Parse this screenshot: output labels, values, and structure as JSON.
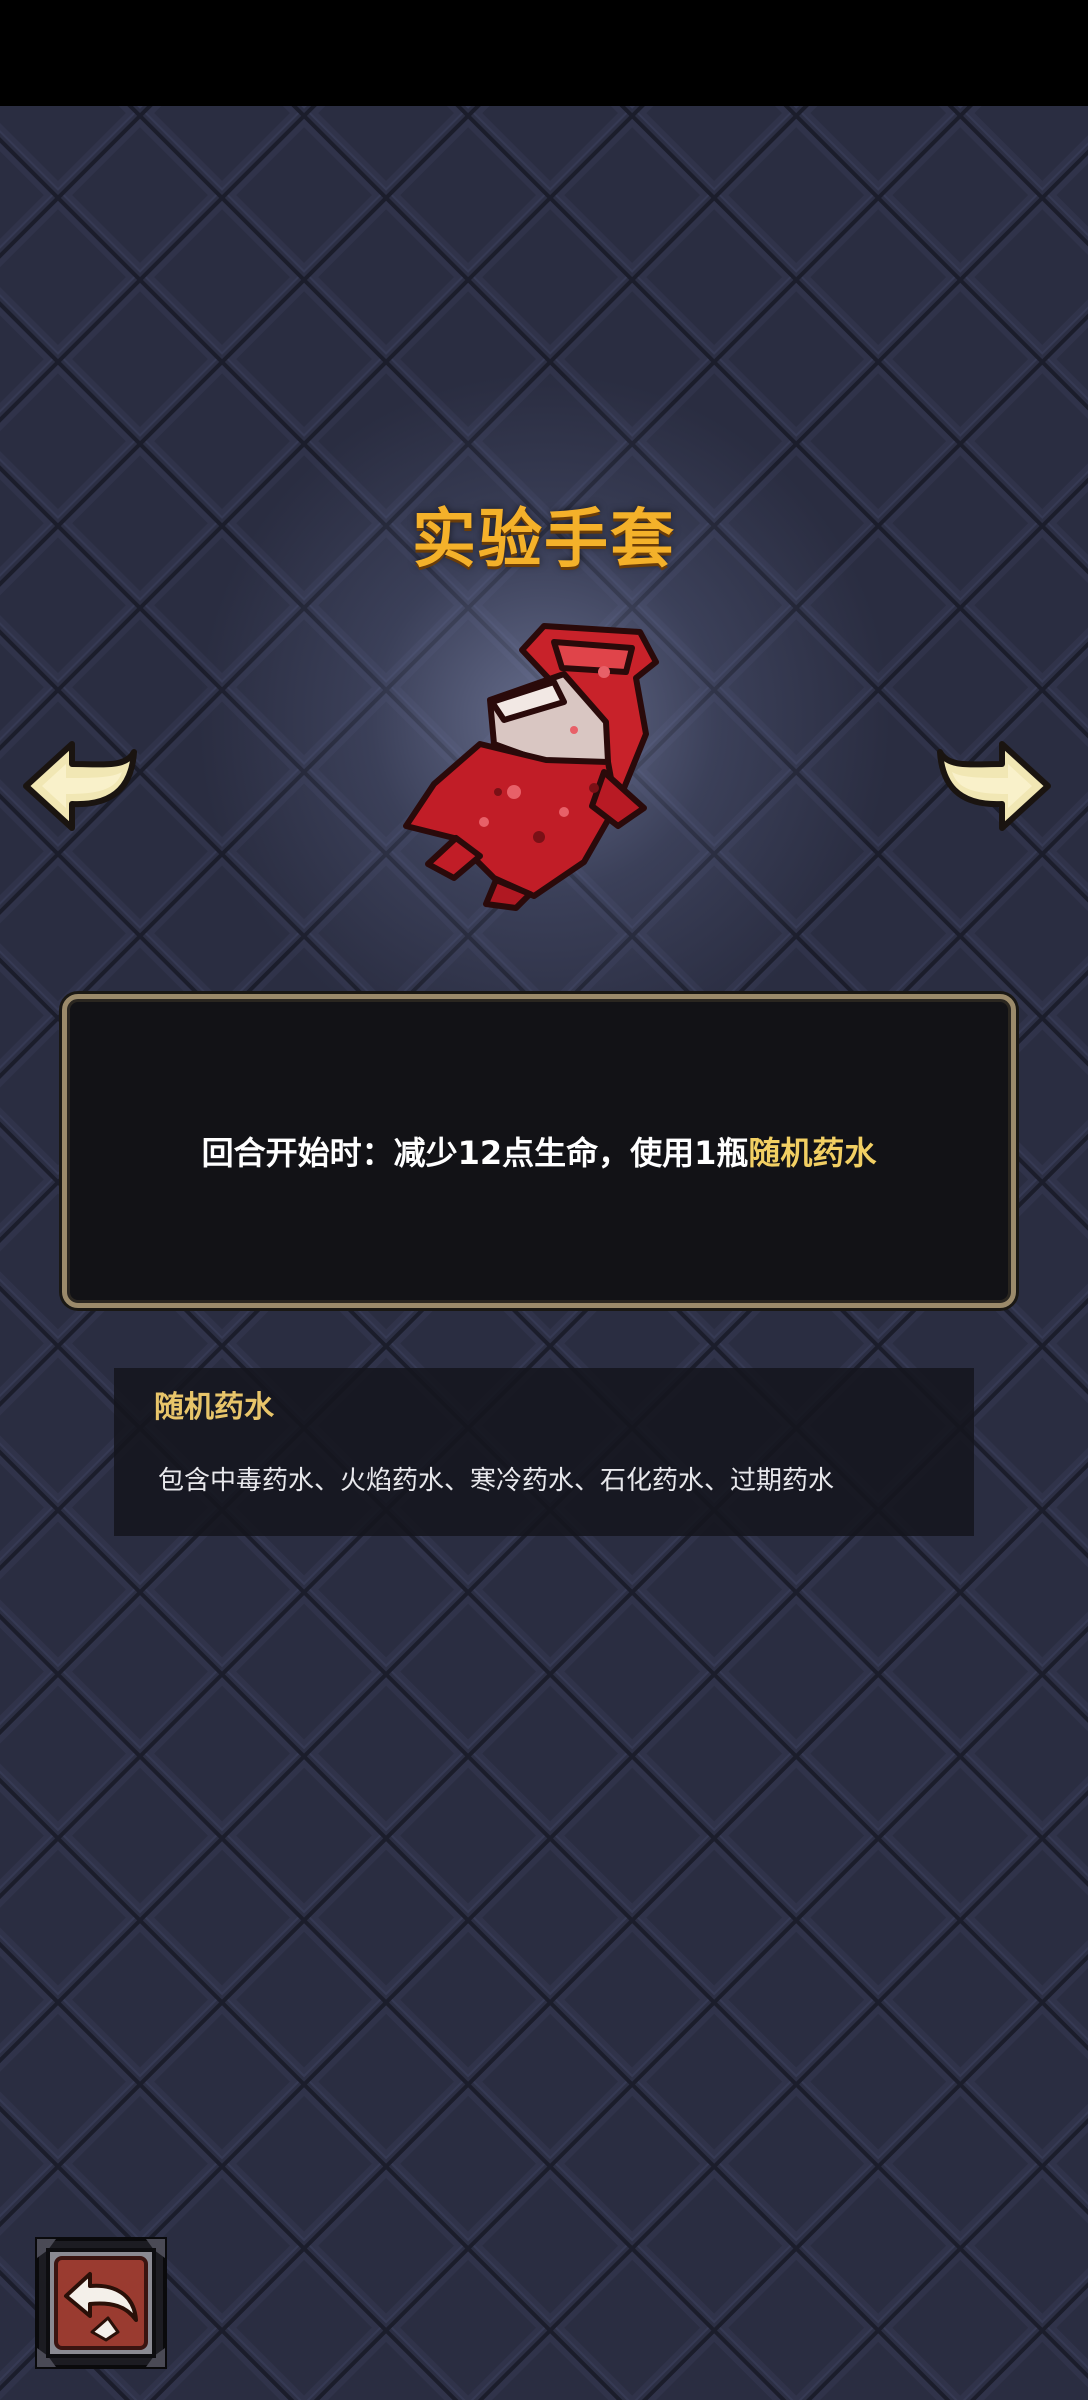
{
  "item": {
    "name": "实验手套",
    "icon": "red-glove-icon"
  },
  "description": {
    "prefix": "回合开始时：减少12点生命，使用1瓶",
    "keyword": "随机药水"
  },
  "keyword_info": {
    "title": "随机药水",
    "body": "包含中毒药水、火焰药水、寒冷药水、石化药水、过期药水"
  },
  "navigation": {
    "prev_icon": "arrow-left-icon",
    "next_icon": "arrow-right-icon",
    "back_icon": "return-arrow-icon"
  },
  "colors": {
    "title": "#f4b12a",
    "keyword_highlight": "#f2cf63",
    "background": "#2b2e42",
    "panel_border": "#9b8a6a",
    "back_button": "#9a3b30"
  }
}
